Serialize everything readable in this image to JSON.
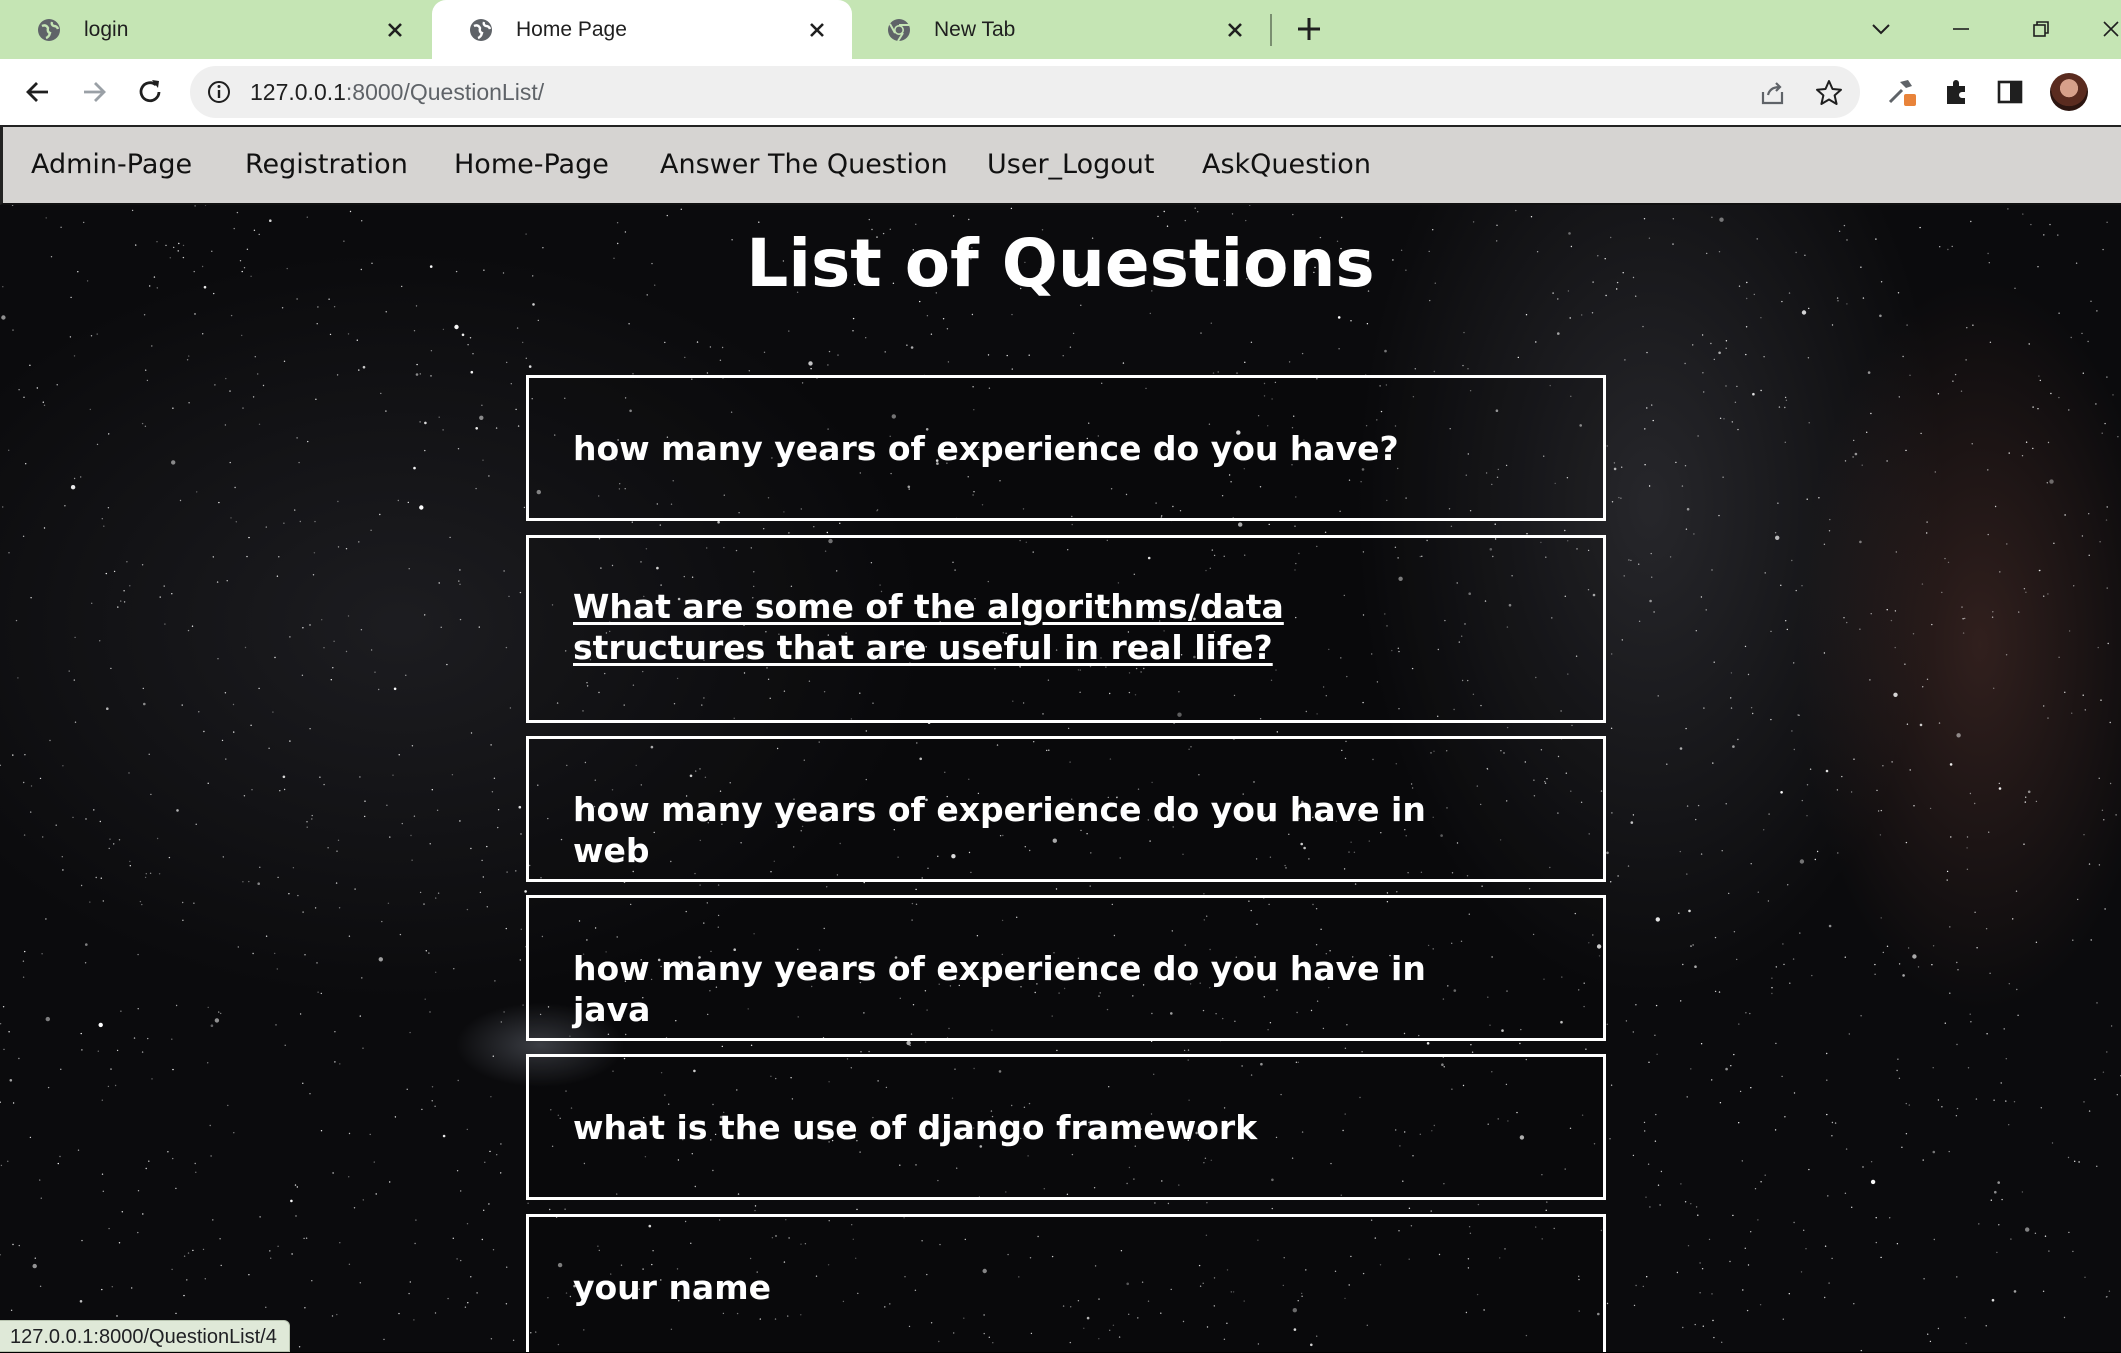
{
  "browser": {
    "tabs": [
      {
        "label": "login",
        "active": false,
        "icon": "globe-icon"
      },
      {
        "label": "Home Page",
        "active": true,
        "icon": "globe-icon"
      },
      {
        "label": "New Tab",
        "active": false,
        "icon": "chrome-icon"
      }
    ],
    "address": {
      "host": "127.0.0.1",
      "path": ":8000/QuestionList/"
    },
    "status_url": "127.0.0.1:8000/QuestionList/4",
    "colors": {
      "tabbar": "#c5e5b4",
      "active_tab": "#ffffff",
      "omnibox": "#efefef"
    }
  },
  "site": {
    "nav": [
      "Admin-Page",
      "Registration",
      "Home-Page",
      "Answer The Question",
      "User_Logout",
      "AskQuestion"
    ],
    "title": "List of Questions",
    "questions": [
      "how many years of experience do you have?",
      "What are some of the algorithms/data structures that are useful in real life?",
      "how many years of experience do you have in web",
      "how many years of experience do you have in java",
      "what is the use of django framework",
      "your name"
    ],
    "hovered_question_index": 1,
    "colors": {
      "nav_bg": "#d6d4d2",
      "text": "#ffffff",
      "card_border": "#ffffff"
    }
  }
}
